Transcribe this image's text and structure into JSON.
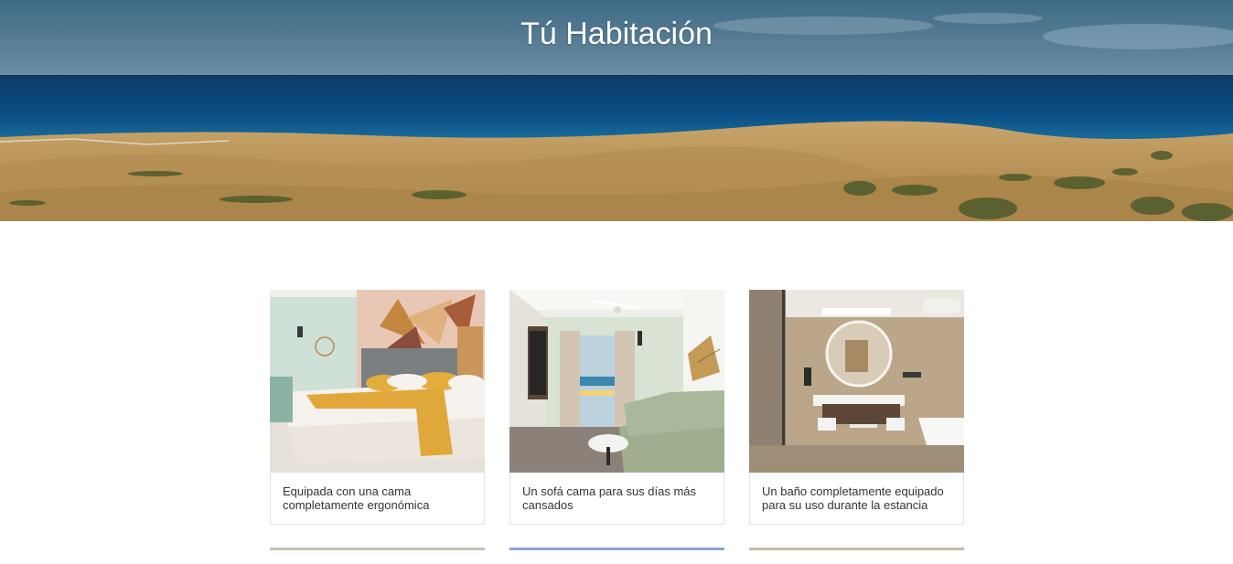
{
  "hero": {
    "title": "Tú Habitación",
    "image": "sand-dunes-ocean-banner"
  },
  "rooms": [
    {
      "caption": "Equipada con una cama completamente ergonómica",
      "image": "bedroom-photo"
    },
    {
      "caption": "Un sofá cama para sus días más cansados",
      "image": "living-room-sofa-photo"
    },
    {
      "caption": "Un baño completamente equipado para su uso durante la estancia",
      "image": "bathroom-photo"
    }
  ],
  "colors": {
    "caption_text": "#333333",
    "card_border": "#e3e3e3",
    "hero_title": "#ffffff"
  }
}
